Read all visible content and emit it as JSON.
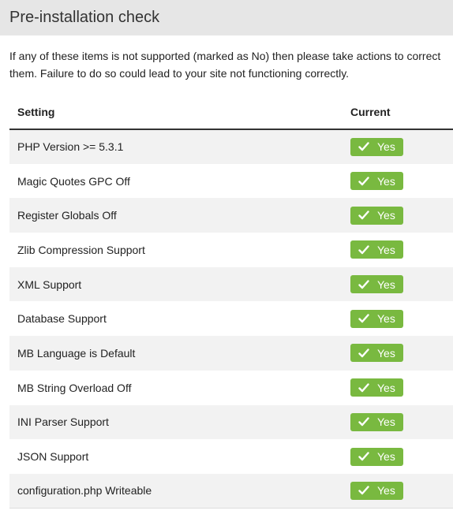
{
  "page": {
    "title": "Pre-installation check",
    "intro": "If any of these items is not supported (marked as No) then please take actions to correct them. Failure to do so could lead to your site not functioning correctly."
  },
  "table": {
    "headers": {
      "setting": "Setting",
      "current": "Current"
    },
    "rows": [
      {
        "setting": "PHP Version >= 5.3.1",
        "status": "Yes"
      },
      {
        "setting": "Magic Quotes GPC Off",
        "status": "Yes"
      },
      {
        "setting": "Register Globals Off",
        "status": "Yes"
      },
      {
        "setting": "Zlib Compression Support",
        "status": "Yes"
      },
      {
        "setting": "XML Support",
        "status": "Yes"
      },
      {
        "setting": "Database Support",
        "status": "Yes"
      },
      {
        "setting": "MB Language is Default",
        "status": "Yes"
      },
      {
        "setting": "MB String Overload Off",
        "status": "Yes"
      },
      {
        "setting": "INI Parser Support",
        "status": "Yes"
      },
      {
        "setting": "JSON Support",
        "status": "Yes"
      },
      {
        "setting": "configuration.php Writeable",
        "status": "Yes"
      }
    ]
  },
  "colors": {
    "header_bg": "#e6e6e6",
    "badge_success": "#79b940",
    "row_stripe": "#f2f2f2"
  },
  "icons": {
    "status": "checkmark-icon"
  }
}
